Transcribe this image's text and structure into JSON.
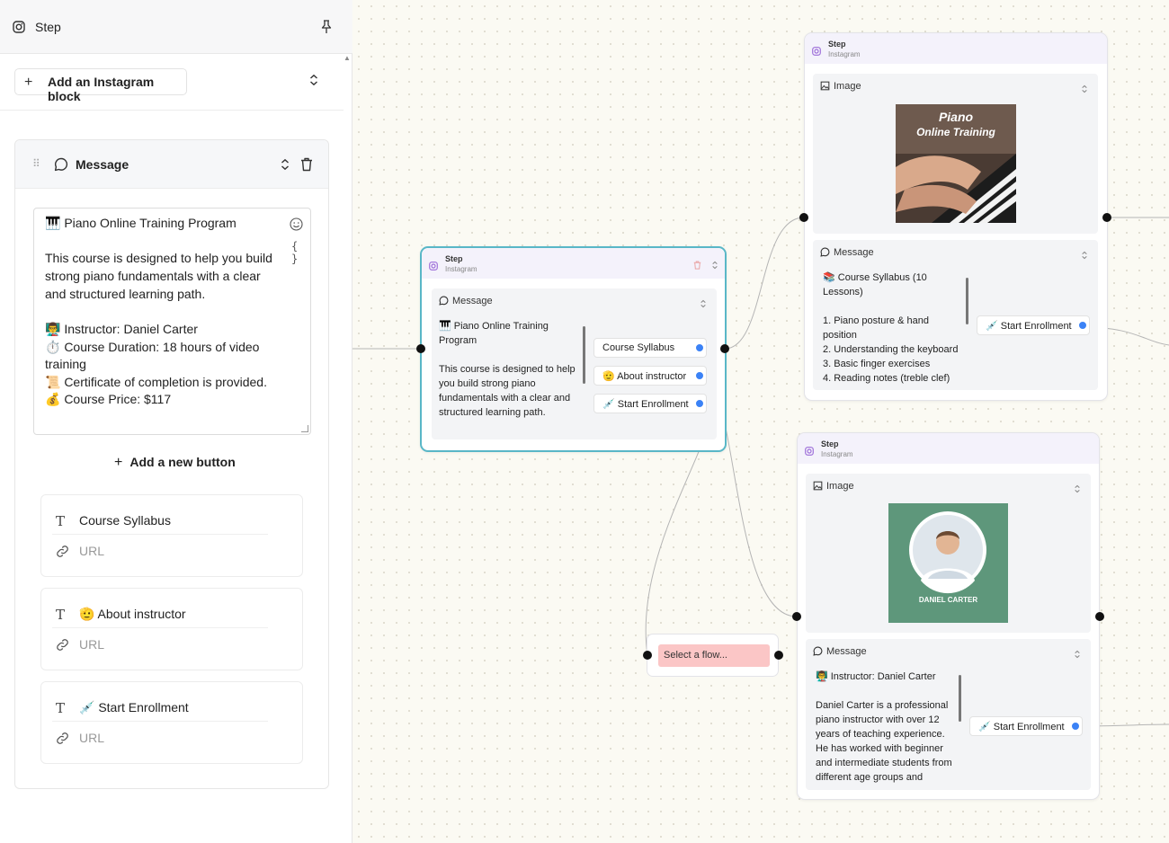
{
  "panel": {
    "title": "Step",
    "add_block_label": "Add an Instagram block",
    "message_block_label": "Message",
    "textarea_lines": [
      "🎹 Piano Online Training Program",
      "",
      "This course is designed to help you build",
      "strong piano fundamentals with a clear",
      "and structured learning path.",
      "",
      "👨‍🏫 Instructor: Daniel Carter",
      "⏱️ Course Duration: 18 hours of video",
      "training",
      "📜 Certificate of completion is provided.",
      "💰 Course Price: $117"
    ],
    "add_button_label": "Add a new button",
    "buttons": [
      {
        "label": "Course Syllabus",
        "url_placeholder": "URL"
      },
      {
        "label": "🫡 About instructor",
        "url_placeholder": "URL"
      },
      {
        "label": "💉 Start Enrollment",
        "url_placeholder": "URL"
      }
    ]
  },
  "canvas": {
    "node_main": {
      "title": "Step",
      "subtitle": "Instagram",
      "section_label": "Message",
      "text_lines": [
        "🎹 Piano Online Training",
        "Program",
        "",
        "This course is designed to help",
        "you build strong piano",
        "fundamentals with a clear and",
        "structured learning path."
      ],
      "buttons": [
        "Course Syllabus",
        "🫡 About instructor",
        "💉 Start Enrollment"
      ]
    },
    "node_syllabus": {
      "title": "Step",
      "subtitle": "Instagram",
      "image_label": "Image",
      "image_text_1": "Piano",
      "image_text_2": "Online Training",
      "message_label": "Message",
      "text_lines": [
        "📚 Course Syllabus (10",
        "Lessons)",
        "",
        "1. Piano posture & hand",
        "position",
        "2. Understanding the keyboard",
        "3. Basic finger exercises",
        "4. Reading notes (treble clef)"
      ],
      "button": "💉 Start Enrollment"
    },
    "node_instructor": {
      "title": "Step",
      "subtitle": "Instagram",
      "image_label": "Image",
      "image_caption": "DANIEL CARTER",
      "message_label": "Message",
      "text_lines": [
        "👨‍🏫 Instructor: Daniel Carter",
        "",
        "Daniel Carter is a professional",
        "piano instructor with over 12",
        "years of teaching experience.",
        "He has worked with beginner",
        "and intermediate students from",
        "different age groups and"
      ],
      "button": "💉 Start Enrollment"
    },
    "flow_select": {
      "placeholder": "Select a flow..."
    }
  },
  "colors": {
    "selected_border": "#59b7c7",
    "handle_blue": "#3b82f6",
    "node_header": "#f4f2fb",
    "flow_select_bg": "#fbc6c6",
    "image_green": "#5e977b",
    "canvas_bg": "#fbfaf3"
  },
  "icons": {
    "panel_header": "instagram-icon",
    "pin": "pin-icon",
    "drag": "grip-icon",
    "message": "message-bubble-icon",
    "delete": "trash-icon",
    "emoji": "emoji-icon",
    "variables": "braces-icon",
    "text": "text-icon",
    "link": "link-icon",
    "image": "image-icon"
  }
}
